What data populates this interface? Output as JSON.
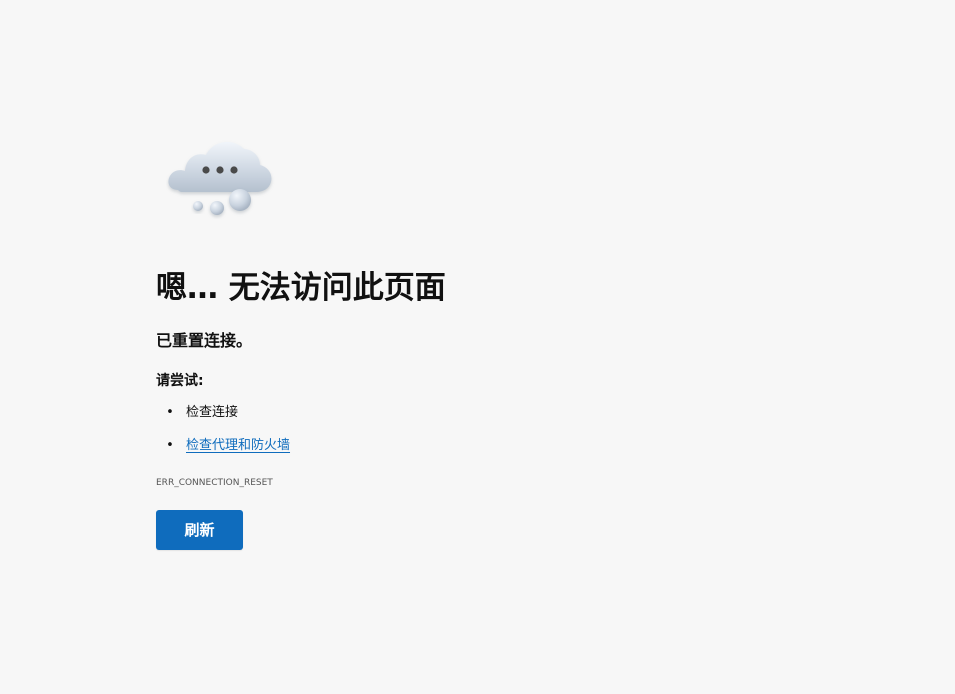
{
  "page": {
    "background": "#f7f7f7",
    "accent": "#0f6cbd"
  },
  "illustration": {
    "icon": "cloud-thinking-icon",
    "dots": "•••"
  },
  "error": {
    "title": "嗯… 无法访问此页面",
    "message": "已重置连接。",
    "try_label": "请尝试:",
    "suggestions": [
      {
        "text": "检查连接",
        "link": false
      },
      {
        "text": "检查代理和防火墙",
        "link": true
      }
    ],
    "code": "ERR_CONNECTION_RESET"
  },
  "actions": {
    "refresh_label": "刷新"
  }
}
